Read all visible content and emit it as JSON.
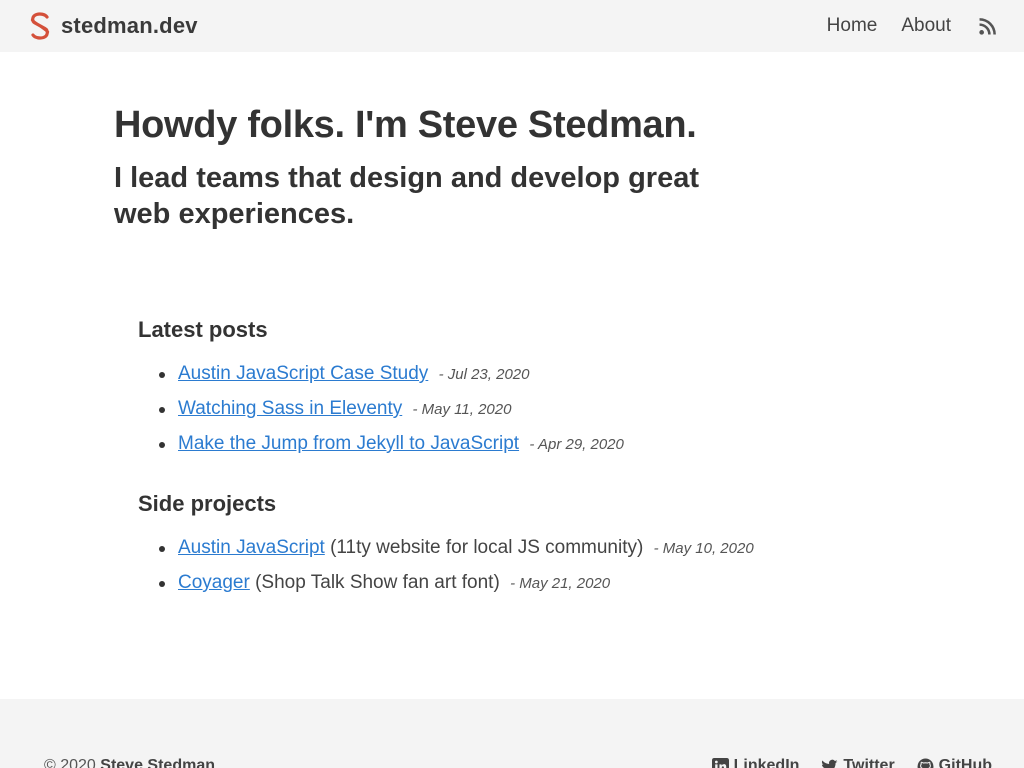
{
  "header": {
    "brand_name": "stedman.dev",
    "logo_icon": "s-logo-icon",
    "nav": [
      {
        "label": "Home"
      },
      {
        "label": "About"
      }
    ],
    "rss_icon": "rss-icon",
    "accent_color": "#d4503a"
  },
  "hero": {
    "title": "Howdy folks. I'm Steve Stedman.",
    "subtitle": "I lead teams that design and develop great web experiences."
  },
  "latest_posts": {
    "heading": "Latest posts",
    "items": [
      {
        "title": "Austin JavaScript Case Study",
        "date": "- Jul 23, 2020"
      },
      {
        "title": "Watching Sass in Eleventy",
        "date": "- May 11, 2020"
      },
      {
        "title": "Make the Jump from Jekyll to JavaScript",
        "date": "- Apr 29, 2020"
      }
    ]
  },
  "side_projects": {
    "heading": "Side projects",
    "items": [
      {
        "title": "Austin JavaScript",
        "description": "(11ty website for local JS community)",
        "date": "- May 10, 2020"
      },
      {
        "title": "Coyager",
        "description": "(Shop Talk Show fan art font)",
        "date": "- May 21, 2020"
      }
    ]
  },
  "footer": {
    "copyright_prefix": "© 2020",
    "copyright_name": "Steve Stedman",
    "social": [
      {
        "label": "LinkedIn",
        "icon": "linkedin-icon"
      },
      {
        "label": "Twitter",
        "icon": "twitter-icon"
      },
      {
        "label": "GitHub",
        "icon": "github-icon"
      }
    ]
  },
  "colors": {
    "link": "#2b7bd0",
    "text": "#333333",
    "bar_background": "#f4f4f4"
  }
}
